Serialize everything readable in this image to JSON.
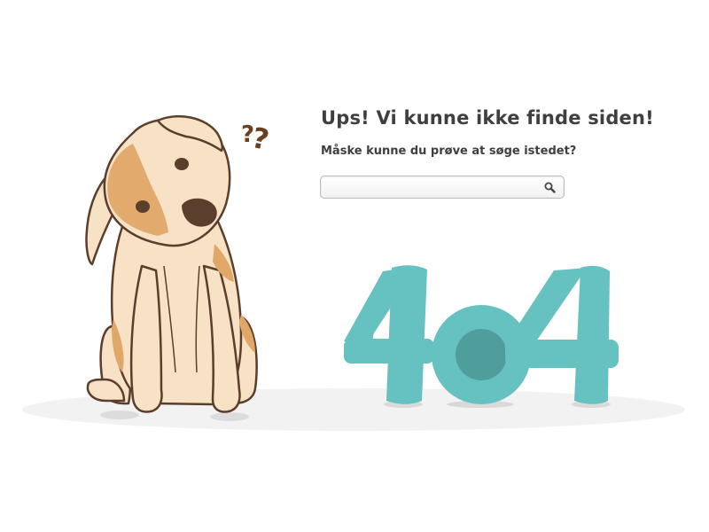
{
  "page": {
    "headline": "Ups! Vi kunne ikke finde siden!",
    "subheadline": "Måske kunne du prøve at søge istedet?"
  },
  "search": {
    "value": "",
    "placeholder": "",
    "button_icon": "search-icon"
  },
  "illustration": {
    "code_text": "404",
    "question_marks": "??",
    "colors": {
      "teal": "#66c1c1",
      "teal_dark": "#4f9e9b",
      "dog_cream": "#f7e2c6",
      "dog_spot": "#e1a769",
      "dog_outline": "#5b3e2b",
      "question_brown": "#6b3f1f"
    }
  }
}
